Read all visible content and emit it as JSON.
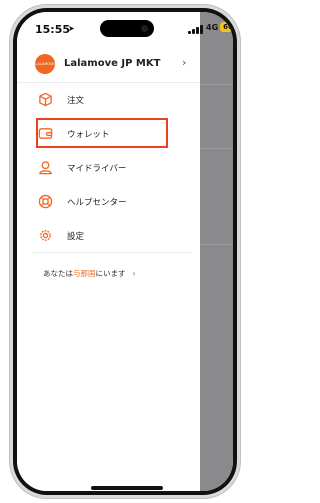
{
  "status": {
    "time": "15:55",
    "network": "4G",
    "battery": "66"
  },
  "account": {
    "name": "Lalamove JP MKT",
    "logo_text": "LALAMOVE"
  },
  "menu": [
    {
      "label": "注文",
      "icon": "box-icon"
    },
    {
      "label": "ウォレット",
      "icon": "wallet-icon"
    },
    {
      "label": "マイドライバー",
      "icon": "driver-icon"
    },
    {
      "label": "ヘルプセンター",
      "icon": "lifebuoy-icon"
    },
    {
      "label": "設定",
      "icon": "gear-icon"
    }
  ],
  "region": {
    "prefix": "あなたは",
    "name": "与那国",
    "suffix": "にいます"
  },
  "colors": {
    "brand": "#f16622",
    "highlight": "#e8421f"
  }
}
